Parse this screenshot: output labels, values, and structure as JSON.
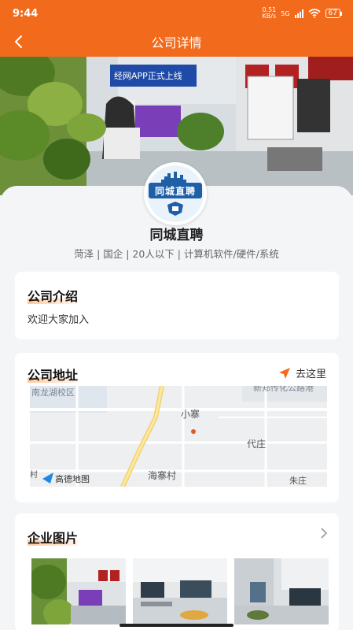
{
  "status_bar": {
    "time": "9:44",
    "net_speed_value": "0.51",
    "net_speed_unit": "KB/s",
    "network": "5G",
    "battery": "67"
  },
  "nav": {
    "title": "公司详情"
  },
  "company": {
    "logo_text": "同城直聘",
    "name": "同城直聘",
    "meta": "菏泽 | 国企 | 20人以下 | 计算机软件/硬件/系统"
  },
  "hero": {
    "banner_text": "经网APP正式上线"
  },
  "intro": {
    "title": "公司介绍",
    "text": "欢迎大家加入"
  },
  "address": {
    "title": "公司地址",
    "goto_label": "去这里",
    "map": {
      "labels": [
        "南龙湖校区",
        "新郑传化公路港",
        "小寨",
        "代庄",
        "海寨村",
        "朱庄",
        "村"
      ],
      "brand": "高德地图"
    }
  },
  "photos": {
    "title": "企业图片"
  },
  "colors": {
    "brand": "#f26b1d",
    "highlight": "#ffc99e"
  }
}
